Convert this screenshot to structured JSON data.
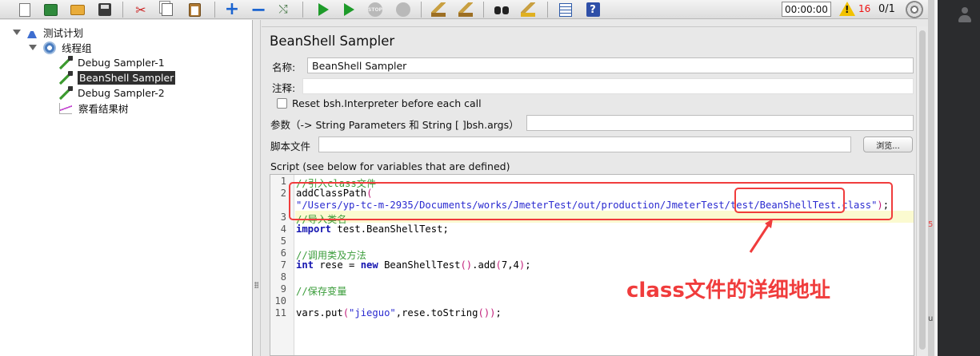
{
  "toolbar": {
    "buttons": [
      "new-icon",
      "templates-icon",
      "open-icon",
      "save-icon",
      "cut-icon",
      "copy-icon",
      "paste-icon",
      "expand-icon",
      "collapse-icon",
      "toggle-icon",
      "start-icon",
      "start-no-pauses-icon",
      "stop-icon",
      "shutdown-icon",
      "clear-icon",
      "clear-all-icon",
      "search-icon",
      "reset-search-icon",
      "function-helper-icon",
      "help-icon"
    ],
    "stop_label": "STOP",
    "timer": "00:00:00",
    "warning_glyph": "!",
    "error_count": "16",
    "thread_count": "0/1"
  },
  "tree": {
    "items": [
      {
        "label": "测试计划",
        "icon": "test-plan-icon"
      },
      {
        "label": "线程组",
        "icon": "thread-group-icon"
      },
      {
        "label": "Debug Sampler-1",
        "icon": "sampler-icon"
      },
      {
        "label": "BeanShell Sampler",
        "icon": "sampler-icon",
        "selected": true
      },
      {
        "label": "Debug Sampler-2",
        "icon": "sampler-icon"
      },
      {
        "label": "察看结果树",
        "icon": "listener-icon"
      }
    ]
  },
  "panel": {
    "title": "BeanShell Sampler",
    "name_label": "名称:",
    "name_value": "BeanShell Sampler",
    "comment_label": "注释:",
    "comment_value": "",
    "reset_label": "Reset bsh.Interpreter before each call",
    "reset_checked": false,
    "params_label": "参数（-> String Parameters 和 String [ ]bsh.args）",
    "params_value": "",
    "file_label": "脚本文件",
    "file_value": "",
    "browse_label": "浏览...",
    "script_label": "Script (see below for variables that are defined)"
  },
  "editor": {
    "line_numbers": [
      "1",
      "2",
      "",
      "3",
      "4",
      "5",
      "6",
      "7",
      "8",
      "9",
      "10",
      "11"
    ],
    "lines": {
      "l1": "//引入class文件",
      "l2_fn": "addClassPath",
      "l2_open": "(",
      "l2b_str": "\"/Users/yp-tc-m-2935/Documents/works/JmeterTest/out/production/JmeterTest/test/BeanShellTest.class\"",
      "l2b_close": ")",
      "l2b_end": ";",
      "l3": "//导入类名",
      "l4_kw": "import",
      "l4_rest": " test.BeanShellTest;",
      "l6": "//调用类及方法",
      "l7_kw": "int",
      "l7_a": " rese = ",
      "l7_new": "new",
      "l7_b": " BeanShellTest",
      "l7_p1": "()",
      "l7_c": ".add",
      "l7_p2": "(",
      "l7_d": "7,4",
      "l7_p3": ")",
      "l7_e": ";",
      "l9": "//保存变量",
      "l11_a": "vars.put",
      "l11_p1": "(",
      "l11_str": "\"jieguo\"",
      "l11_b": ",rese.toString",
      "l11_p2": "()",
      "l11_p3": ")",
      "l11_c": ";"
    }
  },
  "annotation": {
    "text": "class文件的详细地址",
    "color": "#f03c3c"
  },
  "background_fragments": [
    "5",
    "u"
  ]
}
